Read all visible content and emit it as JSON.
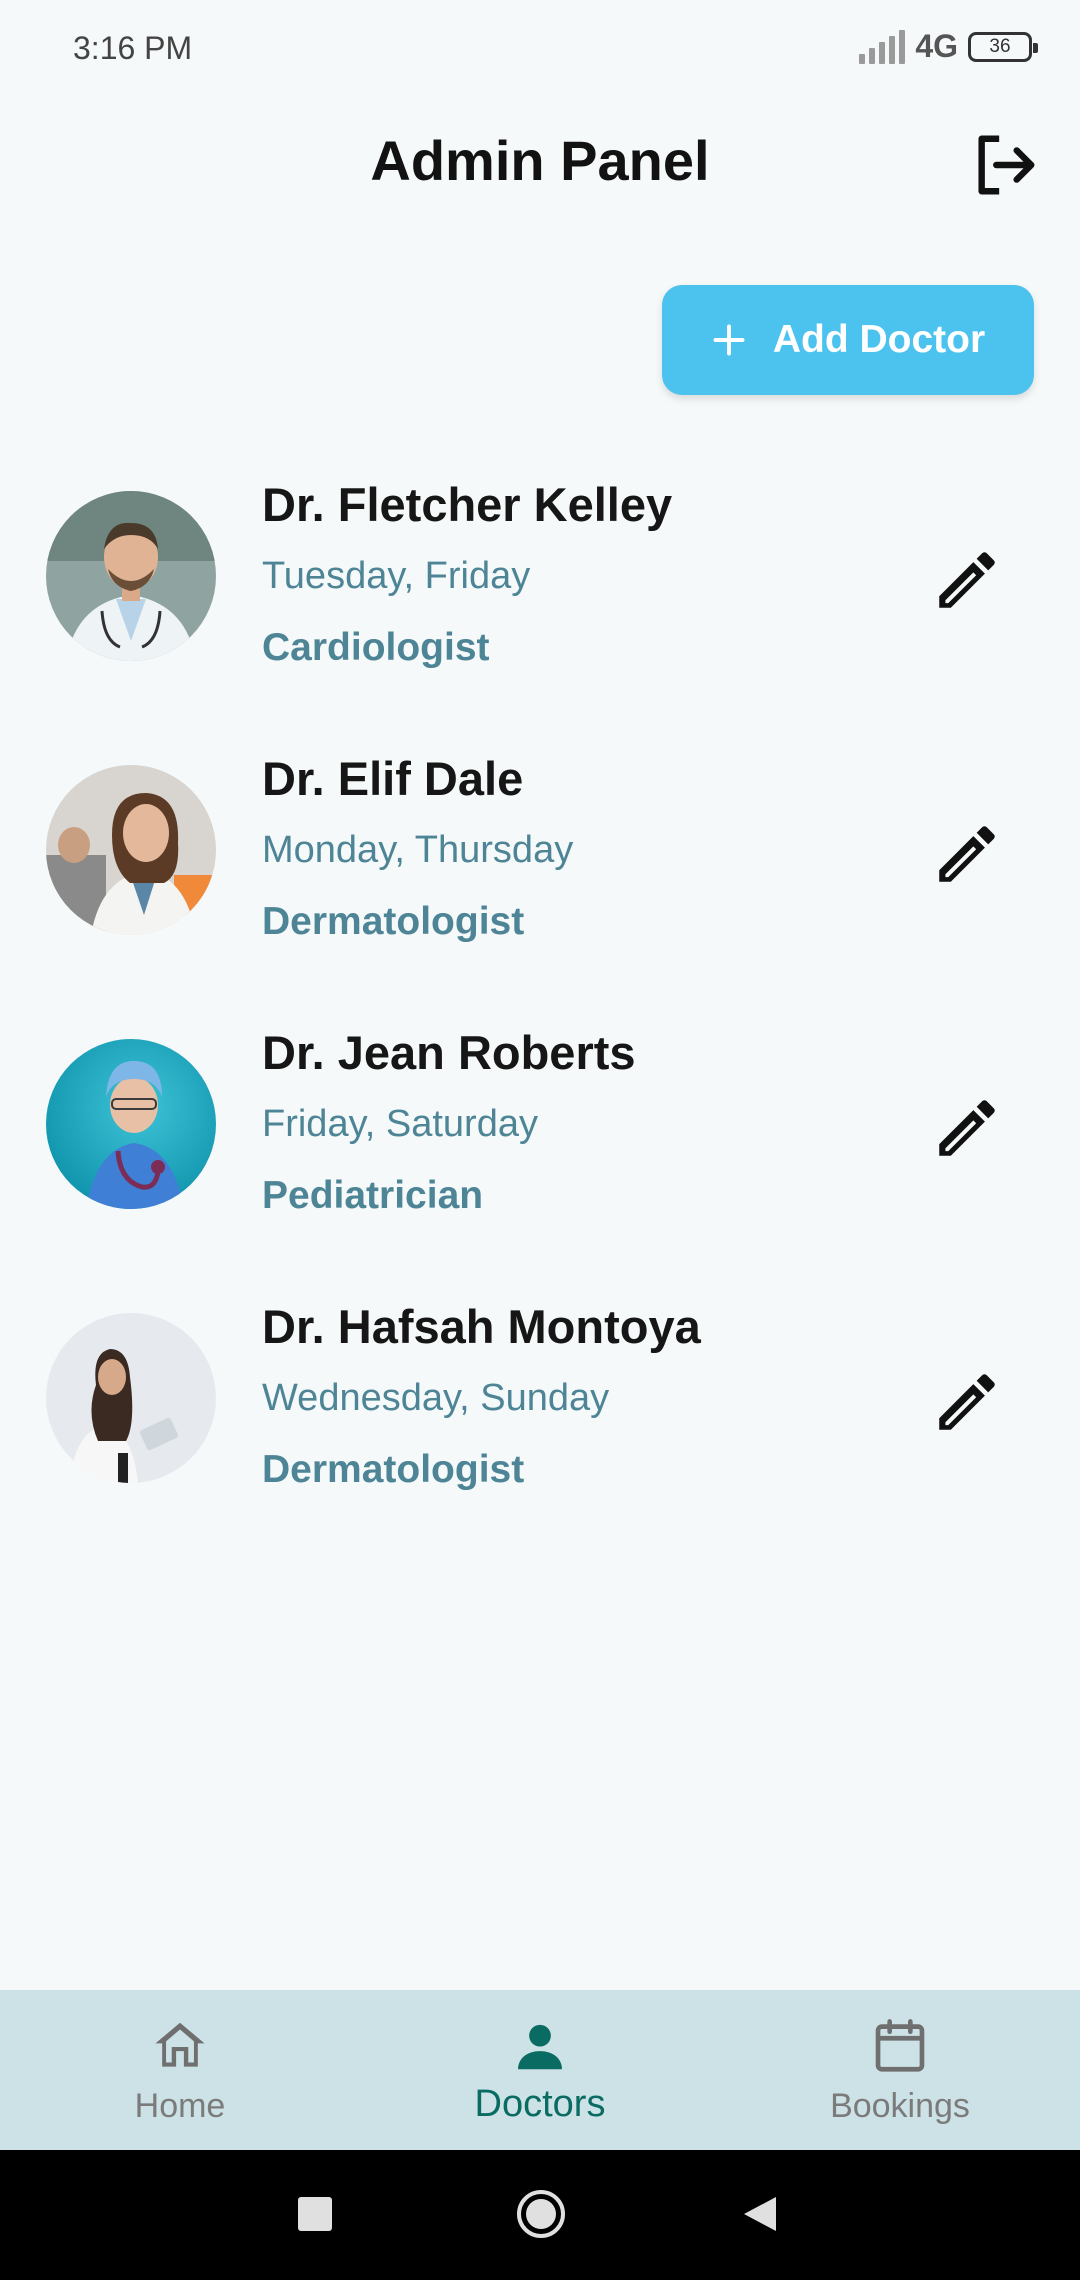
{
  "status_bar": {
    "time": "3:16 PM",
    "network": "4G",
    "battery": "36"
  },
  "header": {
    "title": "Admin Panel",
    "logout_icon": "logout-icon"
  },
  "add_doctor": {
    "label": "Add Doctor",
    "icon": "plus-icon",
    "color": "#4cc3ef"
  },
  "doctors": [
    {
      "name": "Dr. Fletcher Kelley",
      "days": "Tuesday, Friday",
      "specialty": "Cardiologist"
    },
    {
      "name": "Dr. Elif Dale",
      "days": "Monday, Thursday",
      "specialty": "Dermatologist"
    },
    {
      "name": "Dr. Jean Roberts",
      "days": "Friday, Saturday",
      "specialty": "Pediatrician"
    },
    {
      "name": "Dr. Hafsah Montoya",
      "days": "Wednesday, Sunday",
      "specialty": "Dermatologist"
    }
  ],
  "bottom_nav": {
    "items": [
      {
        "label": "Home",
        "icon": "home-icon"
      },
      {
        "label": "Doctors",
        "icon": "person-icon",
        "active": true
      },
      {
        "label": "Bookings",
        "icon": "calendar-icon"
      }
    ]
  },
  "colors": {
    "accent_text": "#4e8596",
    "active_nav": "#0a6b63",
    "nav_background": "#cde2e6"
  }
}
